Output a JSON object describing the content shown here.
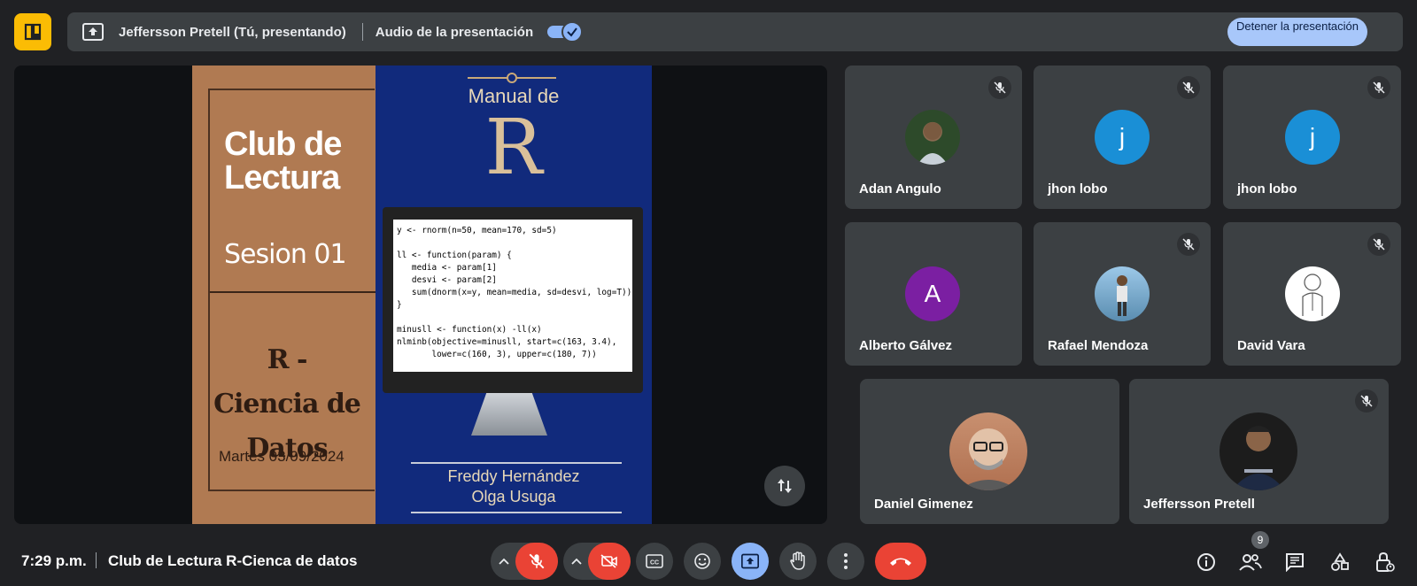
{
  "top_bar": {
    "presenter": "Jeffersson Pretell (Tú, presentando)",
    "audio_label": "Audio de la presentación",
    "audio_enabled": true,
    "stop_button": "Detener la presentación"
  },
  "slide": {
    "left_title": "Club de Lectura",
    "session": "Sesion 01",
    "subtitle": "R - Ciencia de Datos",
    "date": "Martes 03/09/2024",
    "book_title_small": "Manual de",
    "book_title_big": "R",
    "code": "y <- rnorm(n=50, mean=170, sd=5)\n\nll <- function(param) {\n   media <- param[1]\n   desvi <- param[2]\n   sum(dnorm(x=y, mean=media, sd=desvi, log=T))\n}\n\nminusll <- function(x) -ll(x)\nnlminb(objective=minusll, start=c(163, 3.4),\n       lower=c(160, 3), upper=c(180, 7))",
    "author1": "Freddy Hernández",
    "author2": "Olga Usuga"
  },
  "participants": [
    {
      "name": "Adan Angulo",
      "muted": true,
      "avatar": "photo"
    },
    {
      "name": "jhon lobo",
      "muted": true,
      "avatar": "j",
      "color": "#1a8fd6"
    },
    {
      "name": "jhon lobo",
      "muted": true,
      "avatar": "j",
      "color": "#1a8fd6"
    },
    {
      "name": "Alberto Gálvez",
      "muted": false,
      "avatar": "A",
      "color": "#7b1fa2"
    },
    {
      "name": "Rafael Mendoza",
      "muted": true,
      "avatar": "photo"
    },
    {
      "name": "David Vara",
      "muted": true,
      "avatar": "photo"
    },
    {
      "name": "Daniel Gimenez",
      "muted": false,
      "avatar": "photo"
    },
    {
      "name": "Jeffersson Pretell",
      "muted": true,
      "avatar": "photo"
    }
  ],
  "bottom_bar": {
    "time": "7:29 p.m.",
    "meeting_name": "Club de Lectura R-Cienca de datos",
    "participants_count": "9",
    "cc_label": "CC"
  }
}
